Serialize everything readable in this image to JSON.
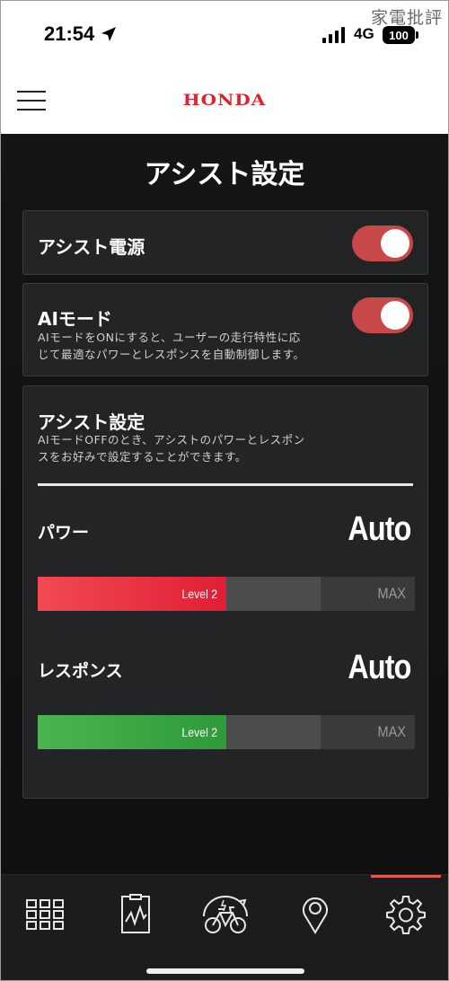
{
  "status_bar": {
    "time": "21:54",
    "network": "4G",
    "battery": "100",
    "watermark": "家電批評"
  },
  "header": {
    "brand": "HONDA",
    "brand_color": "#e4202a"
  },
  "page": {
    "title": "アシスト設定"
  },
  "assist_power": {
    "label": "アシスト電源",
    "enabled": true
  },
  "ai_mode": {
    "label": "AIモード",
    "description_line1": "AIモードをONにすると、ユーザーの走行特性に応",
    "description_line2": "じて最適なパワーとレスポンスを自動制御します。",
    "enabled": true
  },
  "assist_settings": {
    "title": "アシスト設定",
    "description_line1": "AIモードOFFのとき、アシストのパワーとレスポン",
    "description_line2": "スをお好みで設定することができます。",
    "power": {
      "label": "パワー",
      "value": "Auto",
      "level_label": "Level 2",
      "level": 2,
      "max_label": "MAX",
      "max_level": 4,
      "color": "#e8283a"
    },
    "response": {
      "label": "レスポンス",
      "value": "Auto",
      "level_label": "Level 2",
      "level": 2,
      "max_label": "MAX",
      "max_level": 4,
      "color": "#3fa845"
    }
  },
  "nav": {
    "items": [
      {
        "icon": "grid-icon"
      },
      {
        "icon": "activity-log-icon"
      },
      {
        "icon": "bicycle-assist-icon"
      },
      {
        "icon": "map-pin-icon"
      },
      {
        "icon": "gear-icon"
      }
    ],
    "active_index": 4,
    "accent": "#e15a4b"
  }
}
